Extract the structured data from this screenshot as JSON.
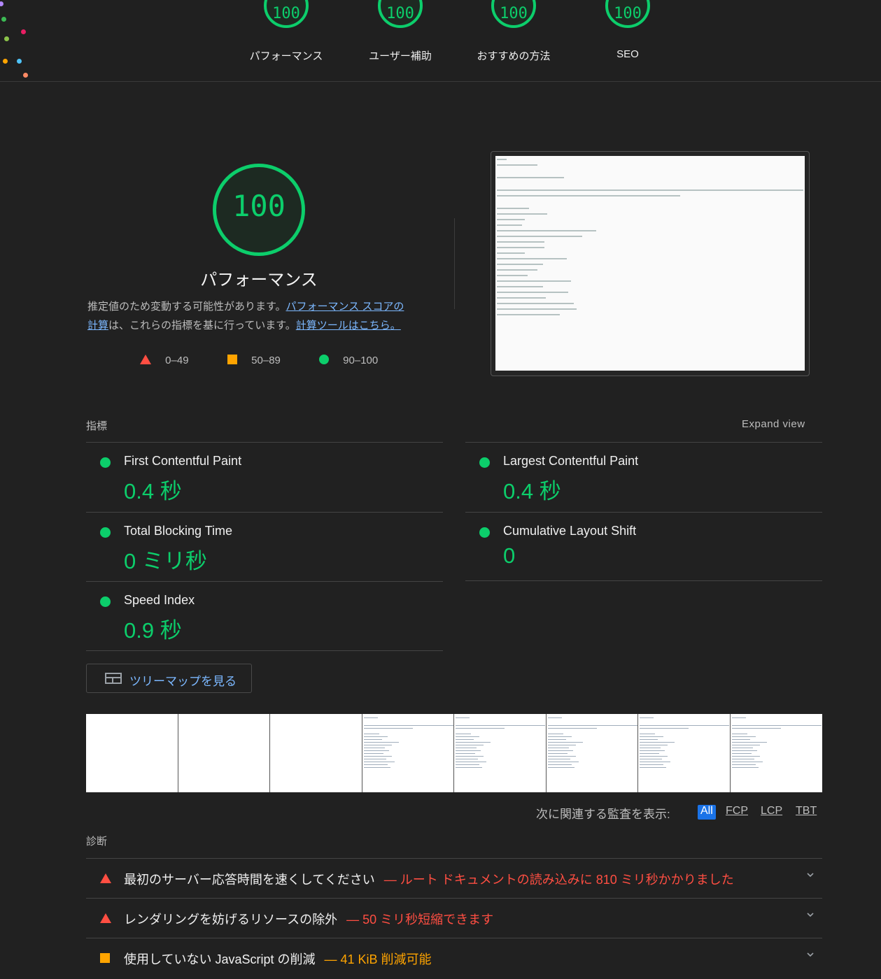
{
  "top_gauges": [
    {
      "score": "100",
      "label": "パフォーマンス"
    },
    {
      "score": "100",
      "label": "ユーザー補助"
    },
    {
      "score": "100",
      "label": "おすすめの方法"
    },
    {
      "score": "100",
      "label": "SEO"
    }
  ],
  "performance": {
    "score": "100",
    "title": "パフォーマンス",
    "description_prefix": "推定値のため変動する可能性があります。",
    "link_scoring_part1": "パフォーマンス スコアの",
    "link_scoring_part2": "計算",
    "description_middle": "は、これらの指標を基に行っています。",
    "link_calculator": "計算ツールはこちら。"
  },
  "legend": {
    "fail": "0–49",
    "average": "50–89",
    "pass": "90–100"
  },
  "colors": {
    "pass": "#0cce6b",
    "average": "#ffa400",
    "fail": "#ff4e42",
    "link": "#7cb8ff",
    "active_chip": "#1a73e8"
  },
  "metrics": {
    "section_label": "指標",
    "expand_label": "Expand view",
    "items": [
      {
        "name": "First Contentful Paint",
        "value": "0.4 秒"
      },
      {
        "name": "Largest Contentful Paint",
        "value": "0.4 秒"
      },
      {
        "name": "Total Blocking Time",
        "value": "0 ミリ秒"
      },
      {
        "name": "Cumulative Layout Shift",
        "value": "0"
      },
      {
        "name": "Speed Index",
        "value": "0.9 秒"
      }
    ]
  },
  "treemap_button": "ツリーマップを見る",
  "filter": {
    "label": "次に関連する監査を表示:",
    "chips": [
      "All",
      "FCP",
      "LCP",
      "TBT"
    ]
  },
  "diagnostics": {
    "section_label": "診断",
    "items": [
      {
        "severity": "fail",
        "title": "最初のサーバー応答時間を速くしてください",
        "detail": "— ルート ドキュメントの読み込みに 810 ミリ秒かかりました"
      },
      {
        "severity": "fail",
        "title": "レンダリングを妨げるリソースの除外",
        "detail": "— 50 ミリ秒短縮できます"
      },
      {
        "severity": "average",
        "title": "使用していない JavaScript の削減",
        "detail": "— 41 KiB 削減可能"
      }
    ]
  }
}
